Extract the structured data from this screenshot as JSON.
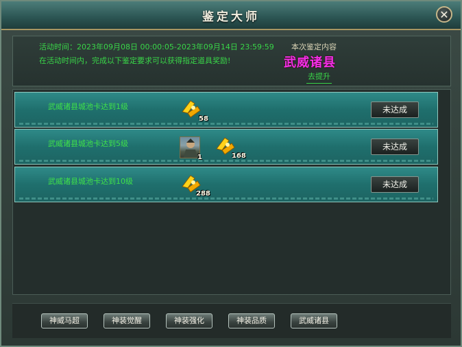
{
  "window": {
    "title": "鉴定大师",
    "close_icon": "close-icon"
  },
  "info": {
    "activity_time": "活动时间：2023年09月08日 00:00:05-2023年09月14日 23:59:59",
    "instruction": "在活动时间内，完成以下鉴定要求可以获得指定道具奖励!",
    "appraisal_label": "本次鉴定内容",
    "target_name": "武威诸县",
    "go_link": "去提升"
  },
  "tasks": [
    {
      "desc": "武威诸县城池卡达到1级",
      "rewards": [
        {
          "icon": "gold-ingot-icon",
          "count": "58"
        }
      ],
      "status": "未达成"
    },
    {
      "desc": "武威诸县城池卡达到5级",
      "rewards": [
        {
          "icon": "general-portrait-icon",
          "count": "1"
        },
        {
          "icon": "gold-ingot-icon",
          "count": "168"
        }
      ],
      "status": "未达成"
    },
    {
      "desc": "武威诸县城池卡达到10级",
      "rewards": [
        {
          "icon": "gold-ingot-icon",
          "count": "288"
        }
      ],
      "status": "未达成"
    }
  ],
  "footer_tabs": [
    "神威马超",
    "神装觉醒",
    "神装强化",
    "神装品质",
    "武威诸县"
  ],
  "colors": {
    "accent_green": "#39d548",
    "target_magenta": "#f22ee8",
    "row_teal": "#1f6f6d"
  }
}
